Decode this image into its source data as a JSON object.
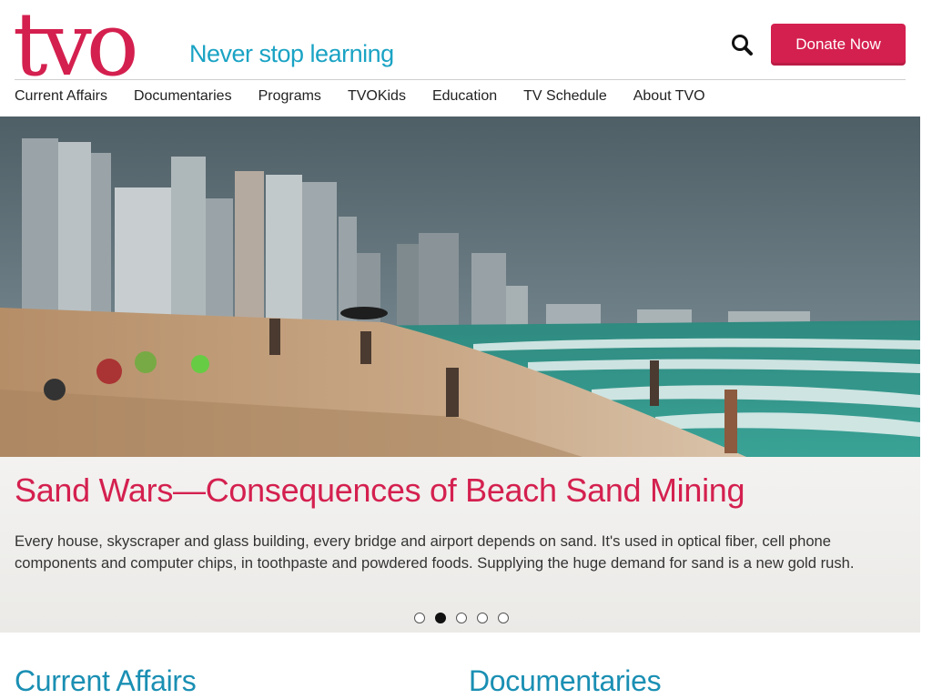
{
  "header": {
    "logo_text": "tvo",
    "tagline": "Never stop learning",
    "donate_label": "Donate Now"
  },
  "nav": {
    "items": [
      {
        "label": "Current Affairs"
      },
      {
        "label": "Documentaries"
      },
      {
        "label": "Programs"
      },
      {
        "label": "TVOKids"
      },
      {
        "label": "Education"
      },
      {
        "label": "TV Schedule"
      },
      {
        "label": "About TVO"
      }
    ]
  },
  "hero": {
    "title": "Sand Wars—Consequences of Beach Sand Mining",
    "description": "Every house, skyscraper and glass building, every bridge and airport depends on sand. It's used in optical fiber, cell phone components and computer chips, in toothpaste and powdered foods. Supplying the huge demand for sand is a new gold rush.",
    "slide_count": 5,
    "active_slide": 2
  },
  "sections": {
    "left_title": "Current Affairs",
    "right_title": "Documentaries"
  },
  "colors": {
    "brand_red": "#d4204f",
    "tagline_blue": "#1aa3c4",
    "section_blue": "#1a8fb3"
  },
  "icons": {
    "search": "search-icon"
  }
}
